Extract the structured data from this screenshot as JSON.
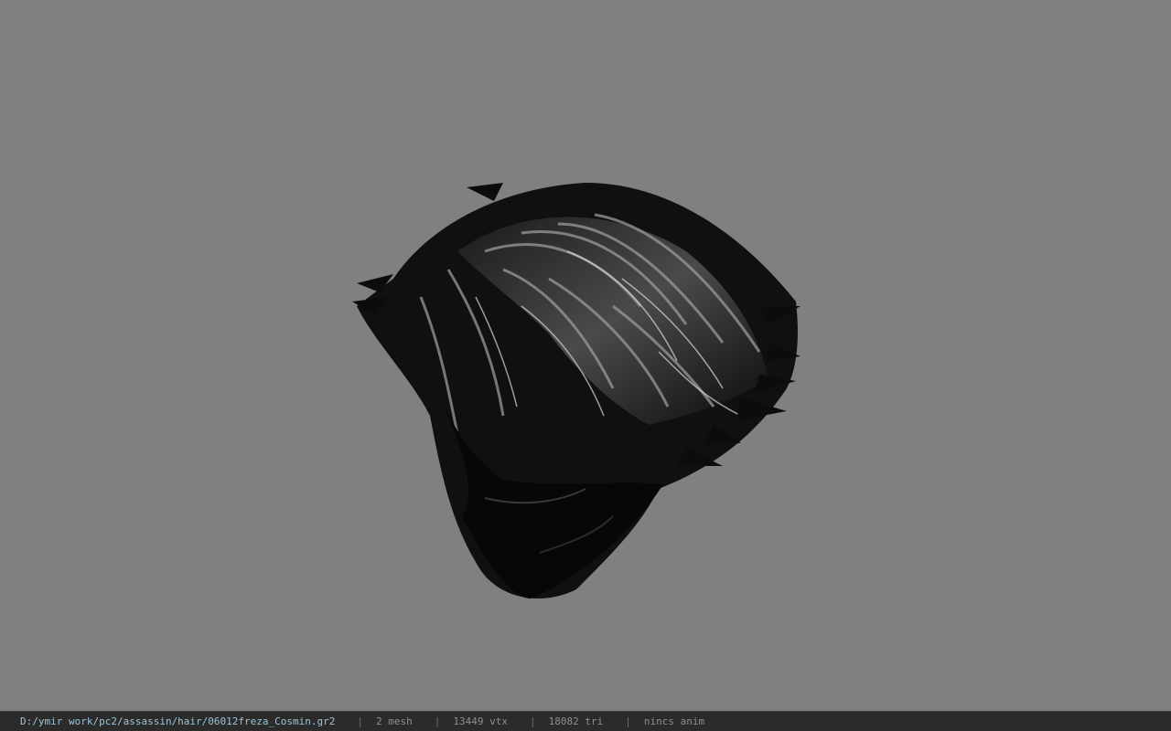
{
  "viewport": {
    "background_color": "#808080",
    "model_name": "hair mesh"
  },
  "statusbar": {
    "file_path": "D:/ymir work/pc2/assassin/hair/06012freza_Cosmin.gr2",
    "separator": "|",
    "mesh_count": "2 mesh",
    "vertex_count": "13449 vtx",
    "triangle_count": "18082 tri",
    "animation": "nincs anim",
    "colors": {
      "background": "#2b2b2b",
      "path_text": "#9ec3d9",
      "text": "#8f8f8f"
    }
  }
}
